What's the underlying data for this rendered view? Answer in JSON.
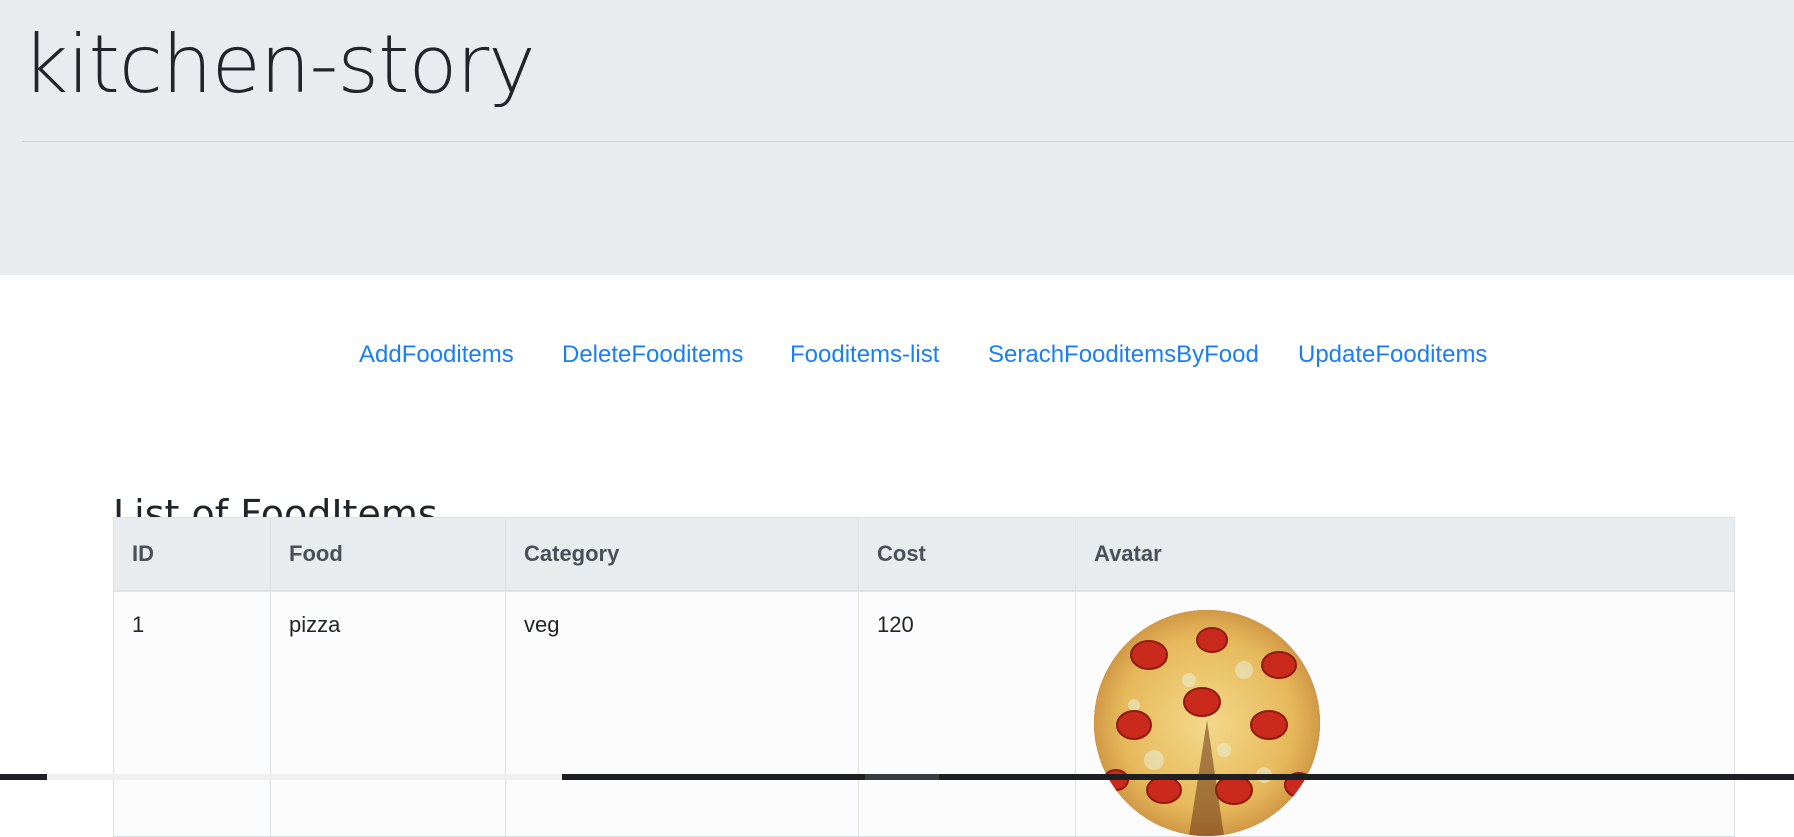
{
  "site": {
    "title": "kitchen-story"
  },
  "nav": {
    "items": [
      {
        "label": "AddFooditems"
      },
      {
        "label": "DeleteFooditems"
      },
      {
        "label": "Fooditems-list"
      },
      {
        "label": "SerachFooditemsByFood"
      },
      {
        "label": "UpdateFooditems"
      }
    ]
  },
  "main": {
    "heading": "List of FoodItems",
    "table": {
      "columns": [
        "ID",
        "Food",
        "Category",
        "Cost",
        "Avatar"
      ],
      "rows": [
        {
          "id": "1",
          "food": "pizza",
          "category": "veg",
          "cost": "120",
          "avatar": "pizza-image"
        }
      ]
    }
  },
  "colors": {
    "header_bg": "#e9ecef",
    "link": "#1a7ff5",
    "text": "#212529"
  }
}
